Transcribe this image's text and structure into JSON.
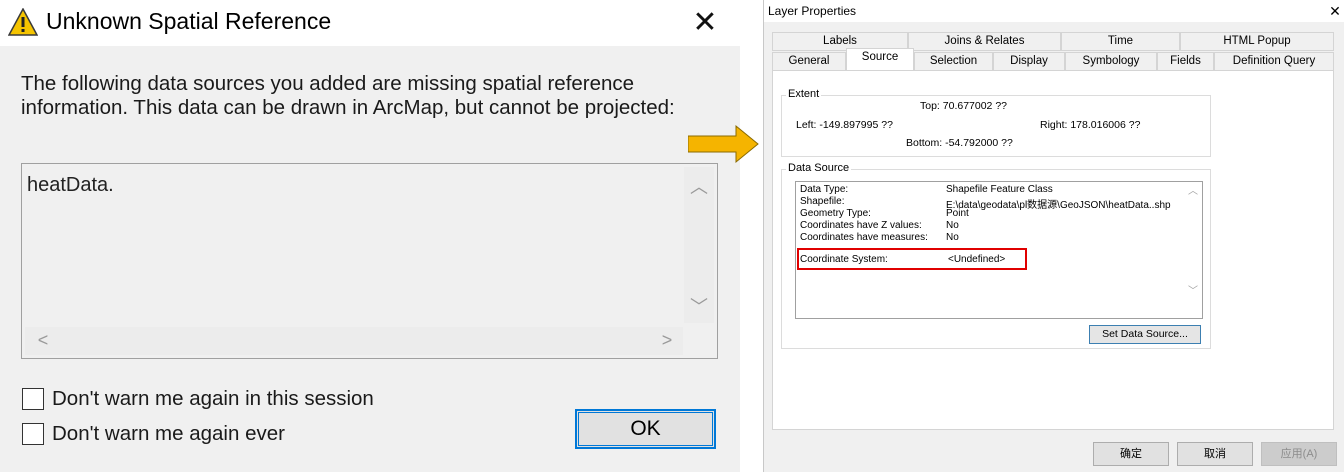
{
  "left_dialog": {
    "title": "Unknown Spatial Reference",
    "close_glyph": "✕",
    "message": "The following data sources you added are missing spatial reference information. This data can be drawn in ArcMap, but cannot be projected:",
    "list_items": [
      "heatData."
    ],
    "checkbox_session": "Don't warn me again in this session",
    "checkbox_ever": "Don't warn me again ever",
    "ok_label": "OK",
    "warning_icon": "warning-triangle-icon"
  },
  "accent_color": "#f5b400",
  "right_dialog": {
    "title": "Layer Properties",
    "close_glyph": "✕",
    "tabs_row1": [
      "Labels",
      "Joins & Relates",
      "Time",
      "HTML Popup"
    ],
    "tabs_row2": [
      "General",
      "Source",
      "Selection",
      "Display",
      "Symbology",
      "Fields",
      "Definition Query"
    ],
    "active_tab": "Source",
    "extent": {
      "label": "Extent",
      "top": "Top:  70.677002 ??",
      "left": "Left: -149.897995 ??",
      "right": "Right:  178.016006 ??",
      "bottom": "Bottom:  -54.792000 ??"
    },
    "data_source": {
      "label": "Data Source",
      "rows": [
        {
          "key": "Data Type:",
          "value": "Shapefile Feature Class"
        },
        {
          "key": "Shapefile:",
          "value": "E:\\data\\geodata\\pl数据源\\GeoJSON\\heatData..shp"
        },
        {
          "key": "Geometry Type:",
          "value": "Point"
        },
        {
          "key": "Coordinates have Z values:",
          "value": "No"
        },
        {
          "key": "Coordinates have measures:",
          "value": "No"
        },
        {
          "key": "Coordinate System:",
          "value": "<Undefined>"
        }
      ],
      "set_button": "Set Data Source..."
    },
    "buttons": {
      "ok": "确定",
      "cancel": "取消",
      "apply": "应用(A)"
    }
  }
}
